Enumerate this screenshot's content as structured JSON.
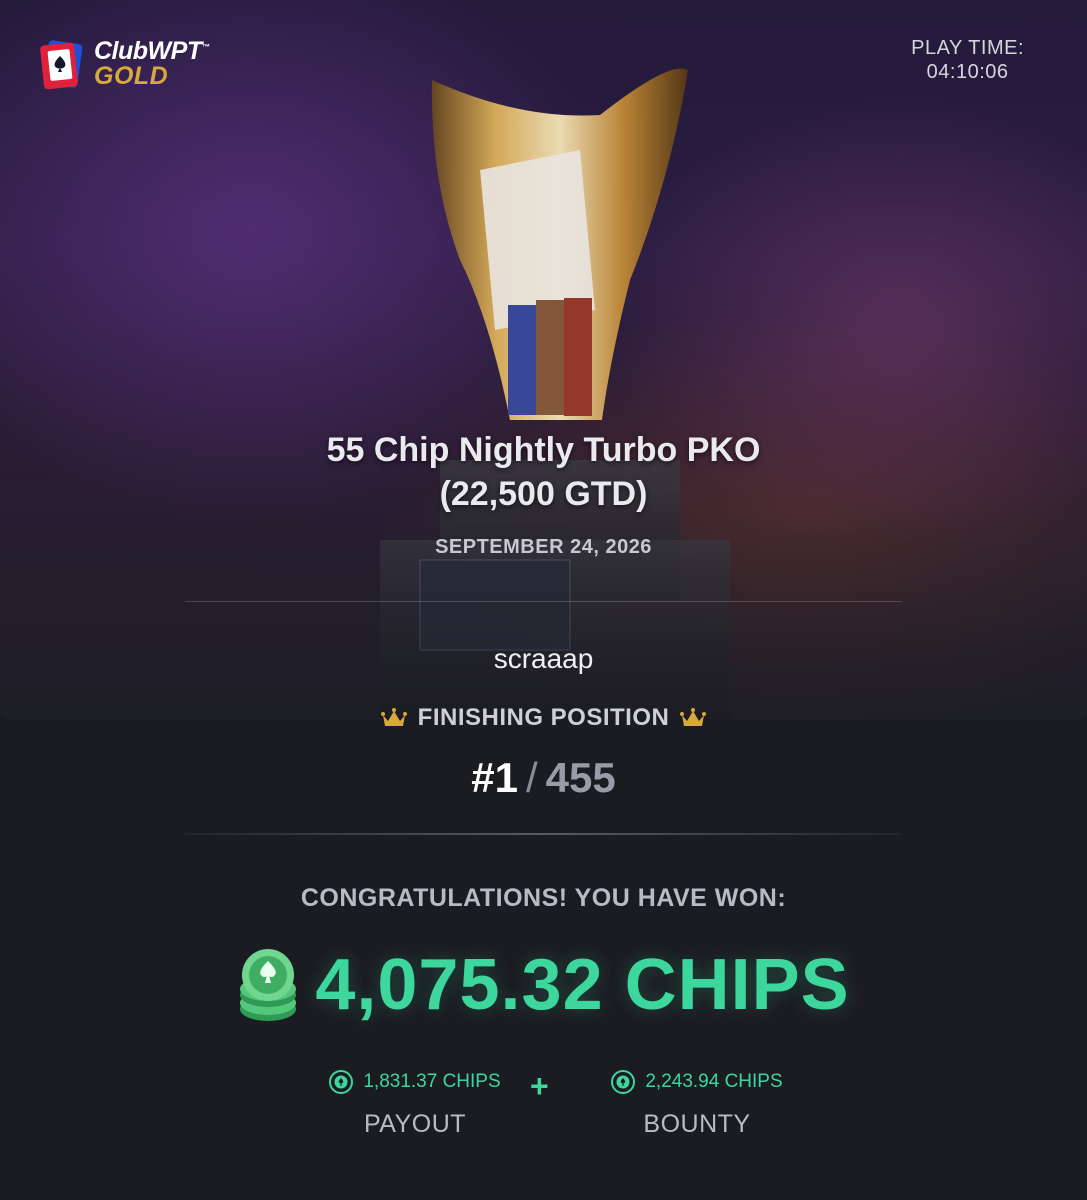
{
  "brand": {
    "club": "ClubWPT",
    "tm": "™",
    "tier": "GOLD"
  },
  "playtime": {
    "label": "PLAY TIME:",
    "value": "04:10:06"
  },
  "tournament": {
    "name_line1": "55 Chip Nightly Turbo PKO",
    "name_line2": "(22,500 GTD)",
    "date": "SEPTEMBER 24, 2026"
  },
  "player": {
    "username": "scraaap"
  },
  "finish": {
    "label": "FINISHING POSITION",
    "rank": "#1",
    "slash": "/",
    "total": "455"
  },
  "winnings": {
    "headline": "CONGRATULATIONS! YOU HAVE WON:",
    "total": "4,075.32 CHIPS",
    "payout_amount": "1,831.37 CHIPS",
    "payout_label": "PAYOUT",
    "plus": "+",
    "bounty_amount": "2,243.94 CHIPS",
    "bounty_label": "BOUNTY"
  },
  "colors": {
    "accent": "#3dd69c",
    "gold": "#d7a83a",
    "background": "#1b1c22"
  }
}
